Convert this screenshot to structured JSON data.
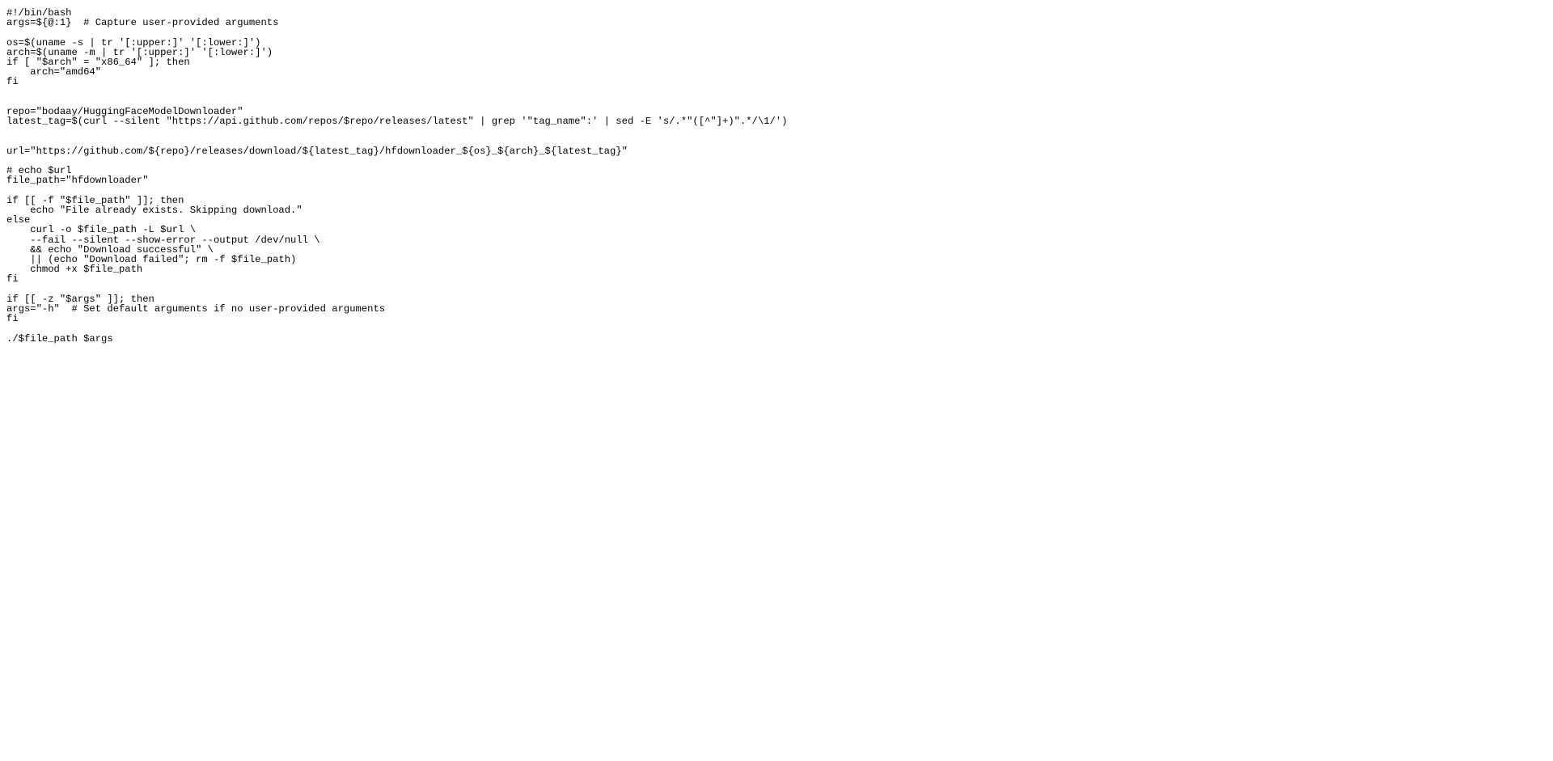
{
  "lines": [
    "#!/bin/bash",
    "args=${@:1}  # Capture user-provided arguments",
    "",
    "os=$(uname -s | tr '[:upper:]' '[:lower:]')",
    "arch=$(uname -m | tr '[:upper:]' '[:lower:]')",
    "if [ \"$arch\" = \"x86_64\" ]; then",
    "    arch=\"amd64\"",
    "fi",
    "",
    "",
    "repo=\"bodaay/HuggingFaceModelDownloader\"",
    "latest_tag=$(curl --silent \"https://api.github.com/repos/$repo/releases/latest\" | grep '\"tag_name\":' | sed -E 's/.*\"([^\"]+)\".*/\\1/')",
    "",
    "",
    "url=\"https://github.com/${repo}/releases/download/${latest_tag}/hfdownloader_${os}_${arch}_${latest_tag}\"",
    "",
    "# echo $url",
    "file_path=\"hfdownloader\"",
    "",
    "if [[ -f \"$file_path\" ]]; then",
    "    echo \"File already exists. Skipping download.\"",
    "else",
    "    curl -o $file_path -L $url \\",
    "    --fail --silent --show-error --output /dev/null \\",
    "    && echo \"Download successful\" \\",
    "    || (echo \"Download failed\"; rm -f $file_path)",
    "    chmod +x $file_path",
    "fi",
    "",
    "if [[ -z \"$args\" ]]; then",
    "args=\"-h\"  # Set default arguments if no user-provided arguments",
    "fi",
    "",
    "./$file_path $args"
  ]
}
